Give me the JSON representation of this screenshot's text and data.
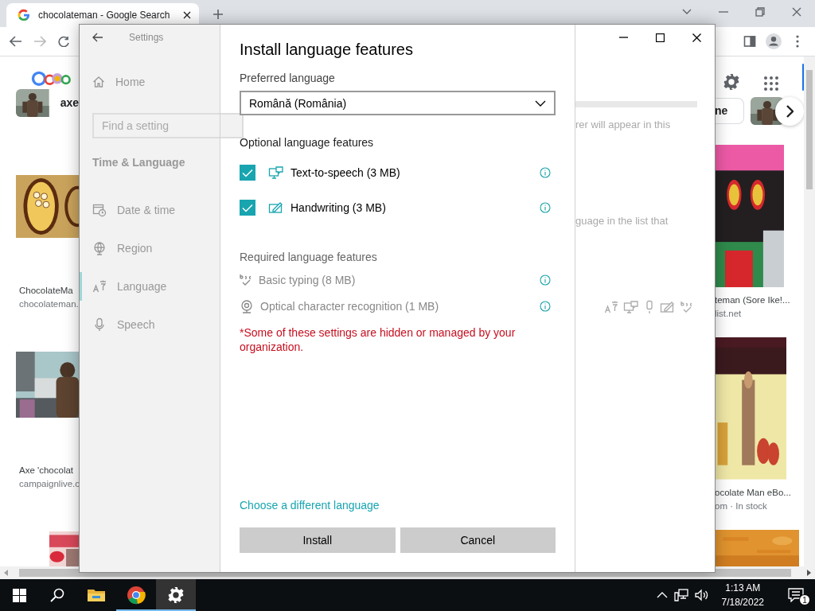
{
  "browser": {
    "tab": {
      "title": "chocolateman - Google Search"
    },
    "left_chip": "axe",
    "left_results": [
      {
        "title": "ChocolateMa",
        "source": "chocolateman."
      },
      {
        "title": "Axe 'chocolat",
        "source": "campaignlive.c"
      }
    ],
    "right_chip": "ne",
    "right_results": [
      {
        "title": "teman (Sore Ike!...",
        "source": "list.net"
      },
      {
        "title": "ocolate Man eBo...",
        "source": "om · In stock"
      }
    ]
  },
  "settings": {
    "title": "Settings",
    "home": "Home",
    "search": {
      "placeholder": "Find a setting"
    },
    "section": "Time & Language",
    "nav": [
      {
        "label": "Date & time",
        "kind": "date",
        "selected": false
      },
      {
        "label": "Region",
        "kind": "region",
        "selected": false
      },
      {
        "label": "Language",
        "kind": "language",
        "selected": true
      },
      {
        "label": "Speech",
        "kind": "speech",
        "selected": false
      }
    ],
    "page_texts": [
      "rer will appear in this",
      "guage in the list that"
    ]
  },
  "dialog": {
    "title": "Install language features",
    "preferred_label": "Preferred language",
    "language": "Română (România)",
    "optional_heading": "Optional language features",
    "optional": [
      {
        "label": "Text-to-speech (3 MB)",
        "kind": "speech",
        "checked": true
      },
      {
        "label": "Handwriting (3 MB)",
        "kind": "handwriting",
        "checked": true
      }
    ],
    "required_heading": "Required language features",
    "required": [
      {
        "label": "Basic typing (8 MB)",
        "kind": "typing"
      },
      {
        "label": "Optical character recognition (1 MB)",
        "kind": "ocr"
      }
    ],
    "note": "*Some of these settings are hidden or managed by your organization.",
    "link": "Choose a different language",
    "buttons": [
      "Install",
      "Cancel"
    ]
  },
  "taskbar": {
    "apps": [
      {
        "kind": "explorer",
        "running": false,
        "selected": false
      },
      {
        "kind": "chrome",
        "running": true,
        "selected": false
      },
      {
        "kind": "settings",
        "running": true,
        "selected": true
      }
    ],
    "time": "1:13 AM",
    "date": "7/18/2022",
    "notifications": "1"
  }
}
